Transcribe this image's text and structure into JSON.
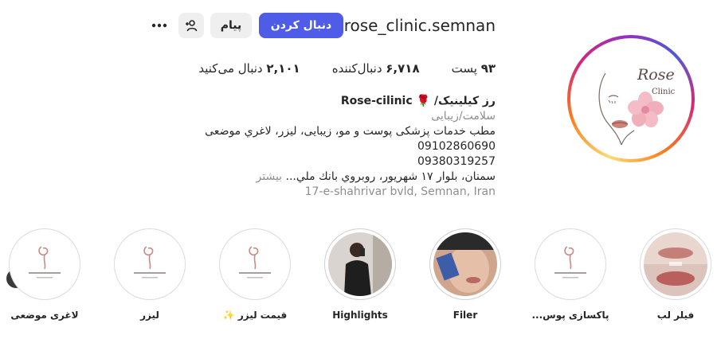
{
  "profile": {
    "username": "rose_clinic.semnan",
    "follow_label": "دنبال کردن",
    "message_label": "پیام",
    "avatar_text": {
      "brand": "Rose",
      "sub": "Clinic"
    }
  },
  "stats": {
    "posts": {
      "count": "۹۳",
      "label": "پست"
    },
    "followers": {
      "count": "۶,۷۱۸",
      "label": "دنبال‌کننده"
    },
    "following": {
      "count": "۲,۱۰۱",
      "label": "دنبال می‌کنید"
    }
  },
  "bio": {
    "name_prefix": "رز کیلینیک/",
    "name_emoji": "🌹",
    "name_suffix": "Rose-cilinic",
    "category": "سلامت/زیبایی",
    "line1": "مطب خدمات پزشکی پوست و مو، زیبایی، لیزر، لاغري موضعی",
    "phone1": "09102860690",
    "phone2": "09380319257",
    "address": "سمنان، بلوار ۱۷ شهریور، روبروي بانك ملي...",
    "more_label": "بیشتر",
    "location": "17-e-shahrivar bvld, Semnan, Iran"
  },
  "highlights": [
    {
      "label": "فیلر لب"
    },
    {
      "label": "پاکسازی پوس..."
    },
    {
      "label": "Filer"
    },
    {
      "label": "Highlights"
    },
    {
      "label": "قیمت لیزر ✨"
    },
    {
      "label": "لیزر"
    },
    {
      "label": "لاغری موضعی"
    }
  ],
  "icons": {
    "more": "more-horizontal-icon",
    "add_user": "add-user-icon",
    "prev": "chevron-left-icon"
  },
  "colors": {
    "follow_button": "#4f5ce8",
    "secondary_button": "#efefef",
    "muted_text": "#8e8e8e"
  }
}
